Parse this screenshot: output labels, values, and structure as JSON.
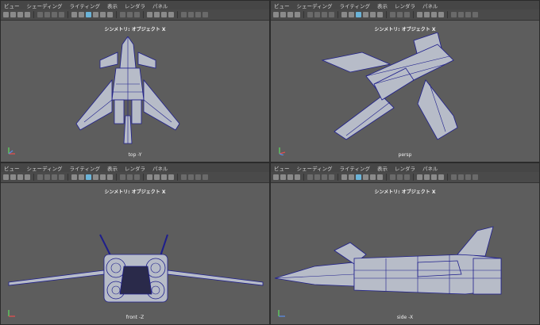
{
  "menu": [
    "ビュー",
    "シェーディング",
    "ライティング",
    "表示",
    "レンダラ",
    "パネル"
  ],
  "panes": [
    {
      "id": "top",
      "title": "シンメトリ: オブジェクト X",
      "camera": "top -Y"
    },
    {
      "id": "persp",
      "title": "シンメトリ: オブジェクト X",
      "camera": "persp"
    },
    {
      "id": "front",
      "title": "シンメトリ: オブジェクト X",
      "camera": "front -Z"
    },
    {
      "id": "side",
      "title": "シンメトリ: オブジェクト X",
      "camera": "side -X"
    }
  ],
  "colors": {
    "viewport_bg": "#5d5d5d",
    "wire": "#1e1e8c",
    "surface": "#b7bcc8",
    "menubar": "#464646"
  }
}
